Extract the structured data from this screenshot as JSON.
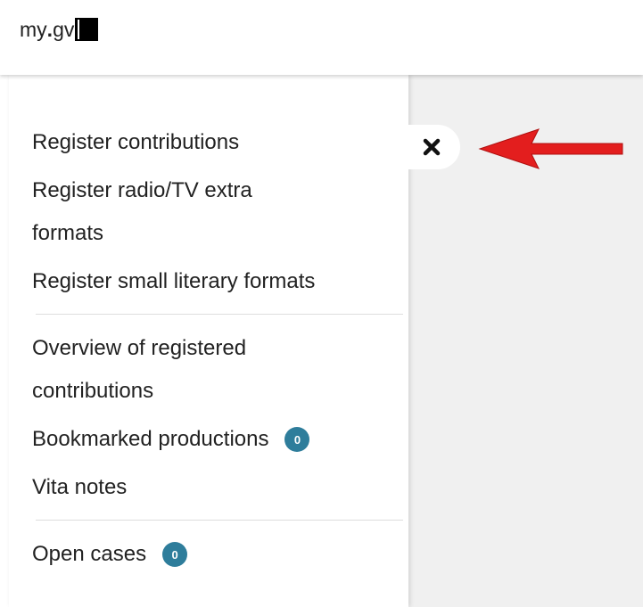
{
  "header": {
    "logo_text": "my",
    "logo_dot": ".",
    "logo_suffix": "gv"
  },
  "menu": {
    "register_contributions": "Register contributions",
    "register_radio_tv_line1": "Register radio/TV extra",
    "register_radio_tv_line2": "formats",
    "register_small_literary": "Register small literary formats",
    "overview_line1": "Overview of registered",
    "overview_line2": "contributions",
    "bookmarked": "Bookmarked productions",
    "bookmarked_count": "0",
    "vita_notes": "Vita notes",
    "open_cases": "Open cases",
    "open_cases_count": "0"
  },
  "icons": {
    "close": "close-icon",
    "arrow": "arrow-left-annotation-icon"
  },
  "colors": {
    "badge": "#2e7d9b",
    "arrow": "#e31e1e",
    "overlay": "#f0f0f0"
  }
}
